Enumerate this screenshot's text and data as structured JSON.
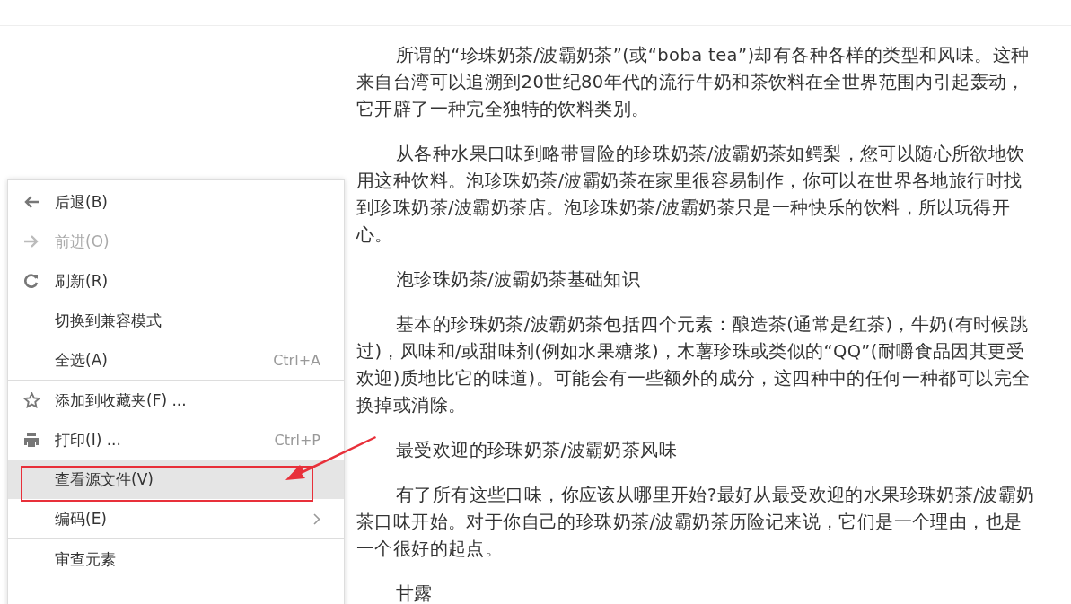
{
  "article": {
    "paragraphs": [
      "所谓的“珍珠奶茶/波霸奶茶”(或“boba tea”)却有各种各样的类型和风味。这种来自台湾可以追溯到20世纪80年代的流行牛奶和茶饮料在全世界范围内引起轰动，它开辟了一种完全独特的饮料类别。",
      "从各种水果口味到略带冒险的珍珠奶茶/波霸奶茶如鳄梨，您可以随心所欲地饮用这种饮料。泡珍珠奶茶/波霸奶茶在家里很容易制作，你可以在世界各地旅行时找到珍珠奶茶/波霸奶茶店。泡珍珠奶茶/波霸奶茶只是一种快乐的饮料，所以玩得开心。",
      "泡珍珠奶茶/波霸奶茶基础知识",
      "基本的珍珠奶茶/波霸奶茶包括四个元素：酿造茶(通常是红茶)，牛奶(有时候跳过)，风味和/或甜味剂(例如水果糖浆)，木薯珍珠或类似的“QQ”(耐嚼食品因其更受欢迎)质地比它的味道)。可能会有一些额外的成分，这四种中的任何一种都可以完全换掉或消除。",
      "最受欢迎的珍珠奶茶/波霸奶茶风味",
      "有了所有这些口味，你应该从哪里开始?最好从最受欢迎的水果珍珠奶茶/波霸奶茶口味开始。对于你自己的珍珠奶茶/波霸奶茶历险记来说，它们是一个理由，也是一个很好的起点。",
      "甘露"
    ]
  },
  "context_menu": {
    "sections": [
      [
        {
          "label": "后退(B)",
          "disabled": false,
          "selected": false,
          "submenu": false
        },
        {
          "label": "前进(O)",
          "disabled": true,
          "selected": false,
          "submenu": false
        },
        {
          "label": "刷新(R)",
          "disabled": false,
          "selected": false,
          "submenu": false
        },
        {
          "label": "切换到兼容模式",
          "disabled": false,
          "selected": false,
          "submenu": false
        },
        {
          "label": "全选(A)",
          "shortcut": "Ctrl+A",
          "disabled": false,
          "selected": false,
          "submenu": false
        }
      ],
      [
        {
          "label": "添加到收藏夹(F) ...",
          "disabled": false,
          "selected": false,
          "submenu": false
        },
        {
          "label": "打印(I) ...",
          "shortcut": "Ctrl+P",
          "disabled": false,
          "selected": false,
          "submenu": false
        },
        {
          "label": "查看源文件(V)",
          "disabled": false,
          "selected": true,
          "submenu": false
        },
        {
          "label": "编码(E)",
          "disabled": false,
          "selected": false,
          "submenu": true
        }
      ],
      [
        {
          "label": "审查元素",
          "disabled": false,
          "selected": false,
          "submenu": false
        }
      ]
    ]
  }
}
